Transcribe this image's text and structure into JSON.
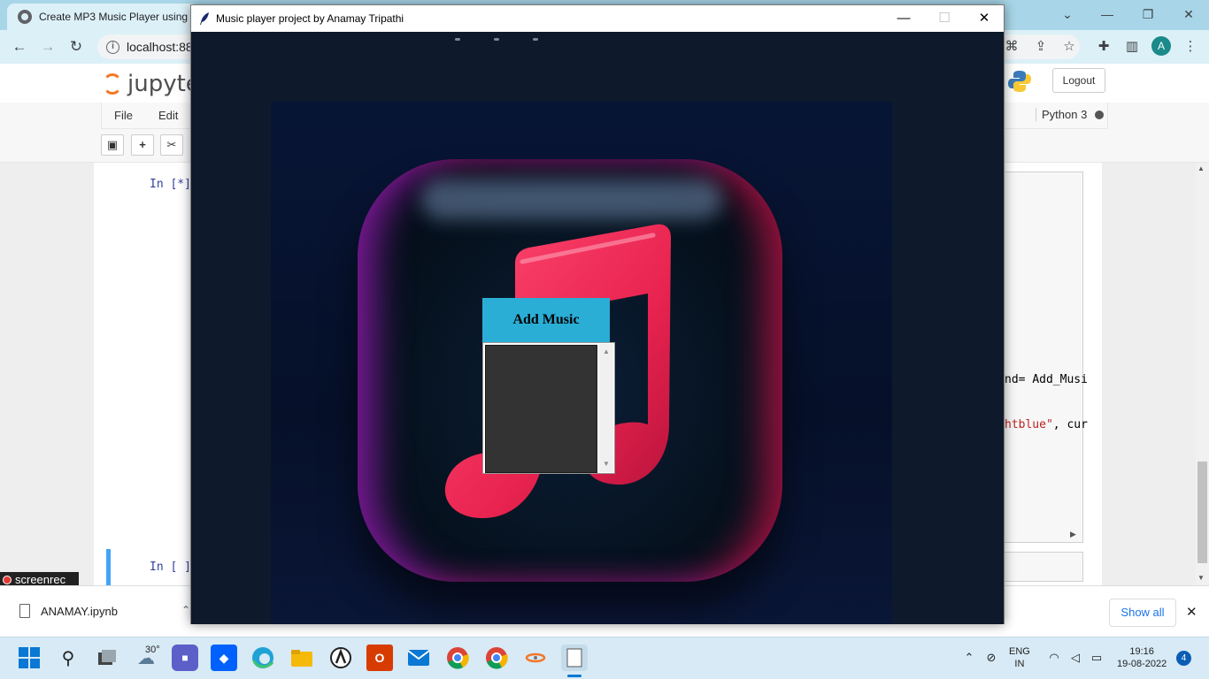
{
  "browser": {
    "tab_title": "Create MP3 Music Player using",
    "tab_title_suffix": "...",
    "address": "localhost:88",
    "window_controls": {
      "minimize": "—",
      "restore": "❐",
      "close": "✕"
    }
  },
  "jupyter": {
    "logo_text": "jupyte",
    "logout_label": "Logout",
    "menu": [
      "File",
      "Edit"
    ],
    "kernel_name": "Python 3",
    "tool_icons": [
      "save-icon",
      "plus-icon",
      "cut-icon"
    ],
    "cell1_prompt": "In [*]",
    "cell2_prompt": "In [ ]",
    "code_visible_lines": [
      {
        "prefix": "nd= ",
        "rest": "Add_Musi"
      },
      {
        "str": "htblue\"",
        "rest": ", cur"
      }
    ]
  },
  "screenrec_label": "screenrec",
  "download_bar": {
    "file_name": "ANAMAY.ipynb",
    "show_all_label": "Show all",
    "close_label": "✕"
  },
  "tk_window": {
    "title": "Music player project by Anamay Tripathi",
    "controls": {
      "minimize": "—",
      "maximize": "☐",
      "close": "✕"
    },
    "add_music_label": "Add Music",
    "playlist_items": [],
    "colors": {
      "button_bg": "#2aaed6",
      "list_bg": "#333333",
      "note_pink": "#e8234f",
      "canvas_bg": "#0e1a2b"
    }
  },
  "taskbar": {
    "weather_temp": "30°",
    "language_line1": "ENG",
    "language_line2": "IN",
    "time": "19:16",
    "date": "19-08-2022",
    "notification_count": "4",
    "apps": [
      "start-icon",
      "search-icon",
      "task-view-icon",
      "weather-icon",
      "zoom-icon",
      "dropbox-icon",
      "edge-icon",
      "file-explorer-icon",
      "app-icon",
      "office-icon",
      "mail-icon",
      "chrome-icon",
      "chrome-profile-icon",
      "jupyter-icon",
      "notepad-icon"
    ]
  }
}
